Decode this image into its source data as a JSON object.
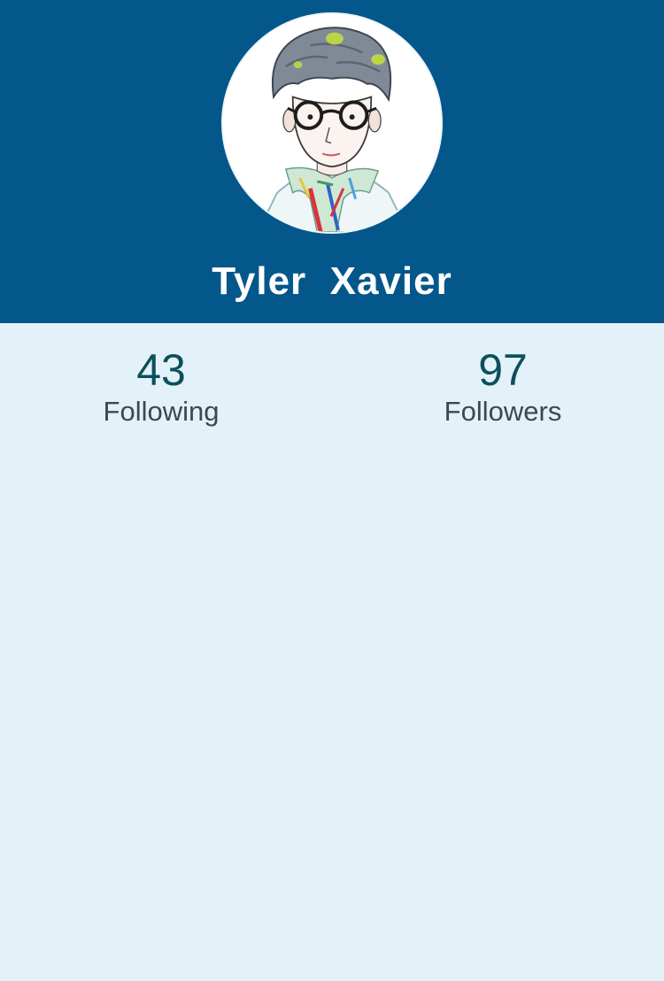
{
  "profile": {
    "name": "Tyler  Xavier",
    "avatar_icon": "user-avatar-illustration"
  },
  "stats": {
    "following": {
      "count": "43",
      "label": "Following"
    },
    "followers": {
      "count": "97",
      "label": "Followers"
    }
  },
  "colors": {
    "header_background": "#03578a",
    "page_background": "#e3f2f8",
    "count_text": "#0d4f5c",
    "label_text": "#3f474c"
  }
}
